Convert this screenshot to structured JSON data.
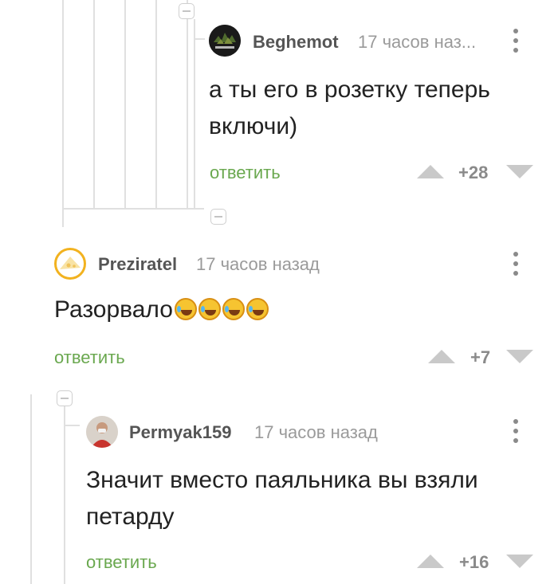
{
  "comments": [
    {
      "username": "Beghemot",
      "time": "17 часов наз...",
      "text": "а ты его в розетку теперь включи)",
      "reply_label": "ответить",
      "rating": "+28",
      "avatar_icon": "dark-camo-avatar-icon"
    },
    {
      "username": "Preziratel",
      "time": "17 часов назад",
      "text": "Разорвало",
      "emoji": [
        "rolling-laughing-face",
        "rolling-laughing-face",
        "rolling-laughing-face",
        "rolling-laughing-face"
      ],
      "reply_label": "ответить",
      "rating": "+7",
      "avatar_icon": "cheese-avatar-icon"
    },
    {
      "username": "Permyak159",
      "time": "17 часов назад",
      "text": "Значит вместо паяльника вы взяли петарду",
      "reply_label": "ответить",
      "rating": "+16",
      "avatar_icon": "person-photo-avatar-icon"
    }
  ],
  "colors": {
    "reply": "#6aa84f",
    "thread_line": "#e0e0e0",
    "muted": "#9a9a9a"
  }
}
